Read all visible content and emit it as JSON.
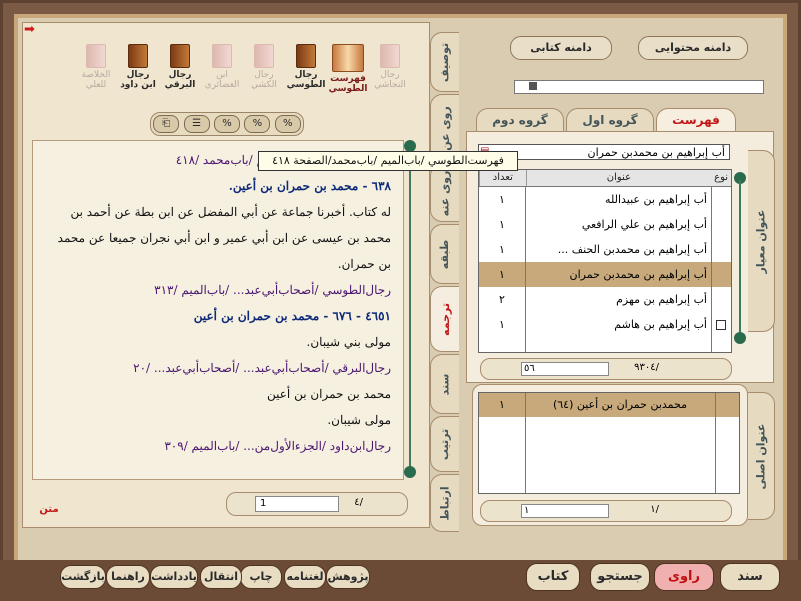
{
  "colors": {
    "accent_red": "#c01818",
    "frame_brown": "#7a5a44",
    "selected_row": "#c7a97c",
    "green_scroll": "#2b6b4d"
  },
  "left": {
    "books": [
      {
        "label": "رجال النجاشي",
        "dim": true
      },
      {
        "label": "فهرست الطوسي",
        "active": true
      },
      {
        "label": "رجال الطوسي"
      },
      {
        "label": "رجال الكشي",
        "dim": true
      },
      {
        "label": "ابن الغضائري",
        "dim": true
      },
      {
        "label": "رجال البرقي"
      },
      {
        "label": "رجال ابن داود"
      },
      {
        "label": "الخلاصة للعلي",
        "dim": true
      }
    ],
    "toolbar_buttons": [
      "⎗",
      "☰",
      "%",
      "%",
      "%"
    ],
    "tooltip": "فهرست‌الطوسي /باب‌الميم /باب‌محمد/الصفحة ٤١٨",
    "lines": [
      {
        "text": "فهرست‌الطوسي /باب‌الميم /باب‌محمد /٤١٨",
        "style": "purple"
      },
      {
        "text": "٦٣٨  -  محمد بن حمران بن أعين.",
        "style": "blue"
      },
      {
        "text": "له كتاب. أخبرنا جماعة عن أبي المفضل عن ابن بطة عن أحمد بن",
        "style": "black"
      },
      {
        "text": "محمد بن عيسى عن ابن أبي عمير و ابن أبي نجران جميعا عن محمد",
        "style": "black"
      },
      {
        "text": "بن حمران.",
        "style": "black"
      },
      {
        "text": "رجال‌الطوسي /أصحاب‌أبي‌عبد... /باب‌الميم /٣١٣",
        "style": "purple"
      },
      {
        "text": "٤٦٥١  -  ٦٧٦  -  محمد بن حمران بن أعين",
        "style": "blue"
      },
      {
        "text": "مولى بني شيبان.",
        "style": "black"
      },
      {
        "text": "رجال‌البرقي /أصحاب‌أبي‌عبد... /أصحاب‌أبي‌عبد... /٢٠",
        "style": "purple"
      },
      {
        "text": "محمد بن حمران بن أعين",
        "style": "black"
      },
      {
        "text": "مولى شيبان.",
        "style": "black"
      },
      {
        "text": "رجال‌ابن‌داود /الجزء‌الأول‌من... /باب‌الميم /٣٠٩",
        "style": "purple"
      }
    ],
    "pager": {
      "value": "1",
      "count": "/٤"
    },
    "matn_tab": "متن"
  },
  "vtabs": [
    "توصيف",
    "روى عن",
    "روى عنه",
    "طبقه",
    "ترجمه",
    "سند",
    "ترتيب",
    "ارتباط"
  ],
  "right": {
    "top_buttons": {
      "content_scope": "دامنه محتوایی",
      "book_scope": "دامنه كتابی"
    },
    "htabs": {
      "index": "فهرست",
      "group1": "گروه اول",
      "group2": "گروه دوم"
    },
    "search_value": "أب إبراهيم بن محمدبن حمران",
    "table_headers": {
      "type": "نوع",
      "title": "عنوان",
      "count": "تعداد"
    },
    "rows": [
      {
        "title": "أب إبراهيم بن عبيدالله",
        "count": "١",
        "checkbox": false,
        "selected": false
      },
      {
        "title": "أب إبراهيم بن علي الرافعي",
        "count": "١",
        "checkbox": false,
        "selected": false
      },
      {
        "title": "أب إبراهيم بن محمدبن الحنف ...",
        "count": "١",
        "checkbox": false,
        "selected": false
      },
      {
        "title": "أب إبراهيم بن محمدبن حمران",
        "count": "١",
        "checkbox": false,
        "selected": true
      },
      {
        "title": "أب إبراهيم بن مهزم",
        "count": "٢",
        "checkbox": false,
        "selected": false
      },
      {
        "title": "أب إبراهيم بن هاشم",
        "count": "١",
        "checkbox": true,
        "selected": false
      }
    ],
    "pager1": {
      "value": "٥٦",
      "count": "/٩٣٠٤"
    },
    "side_tabs": {
      "standard_title": "عنوان معيار",
      "original_title": "عنوان اصلی"
    },
    "original_rows": [
      {
        "title": "محمدبن حمران بن أعين (٦٤)",
        "count": "١"
      }
    ],
    "pager2": {
      "value": "١",
      "count": "/١"
    }
  },
  "bottom": {
    "big_buttons": [
      {
        "label": "سند",
        "red": false
      },
      {
        "label": "راوی",
        "red": true
      },
      {
        "label": "جستجو",
        "red": false
      },
      {
        "label": "كتاب",
        "red": false
      }
    ],
    "small_buttons": [
      "پژوهش",
      "لغتنامه",
      "چاپ",
      "انتقال",
      "یادداشت",
      "راهنما",
      "بازگشت"
    ]
  }
}
